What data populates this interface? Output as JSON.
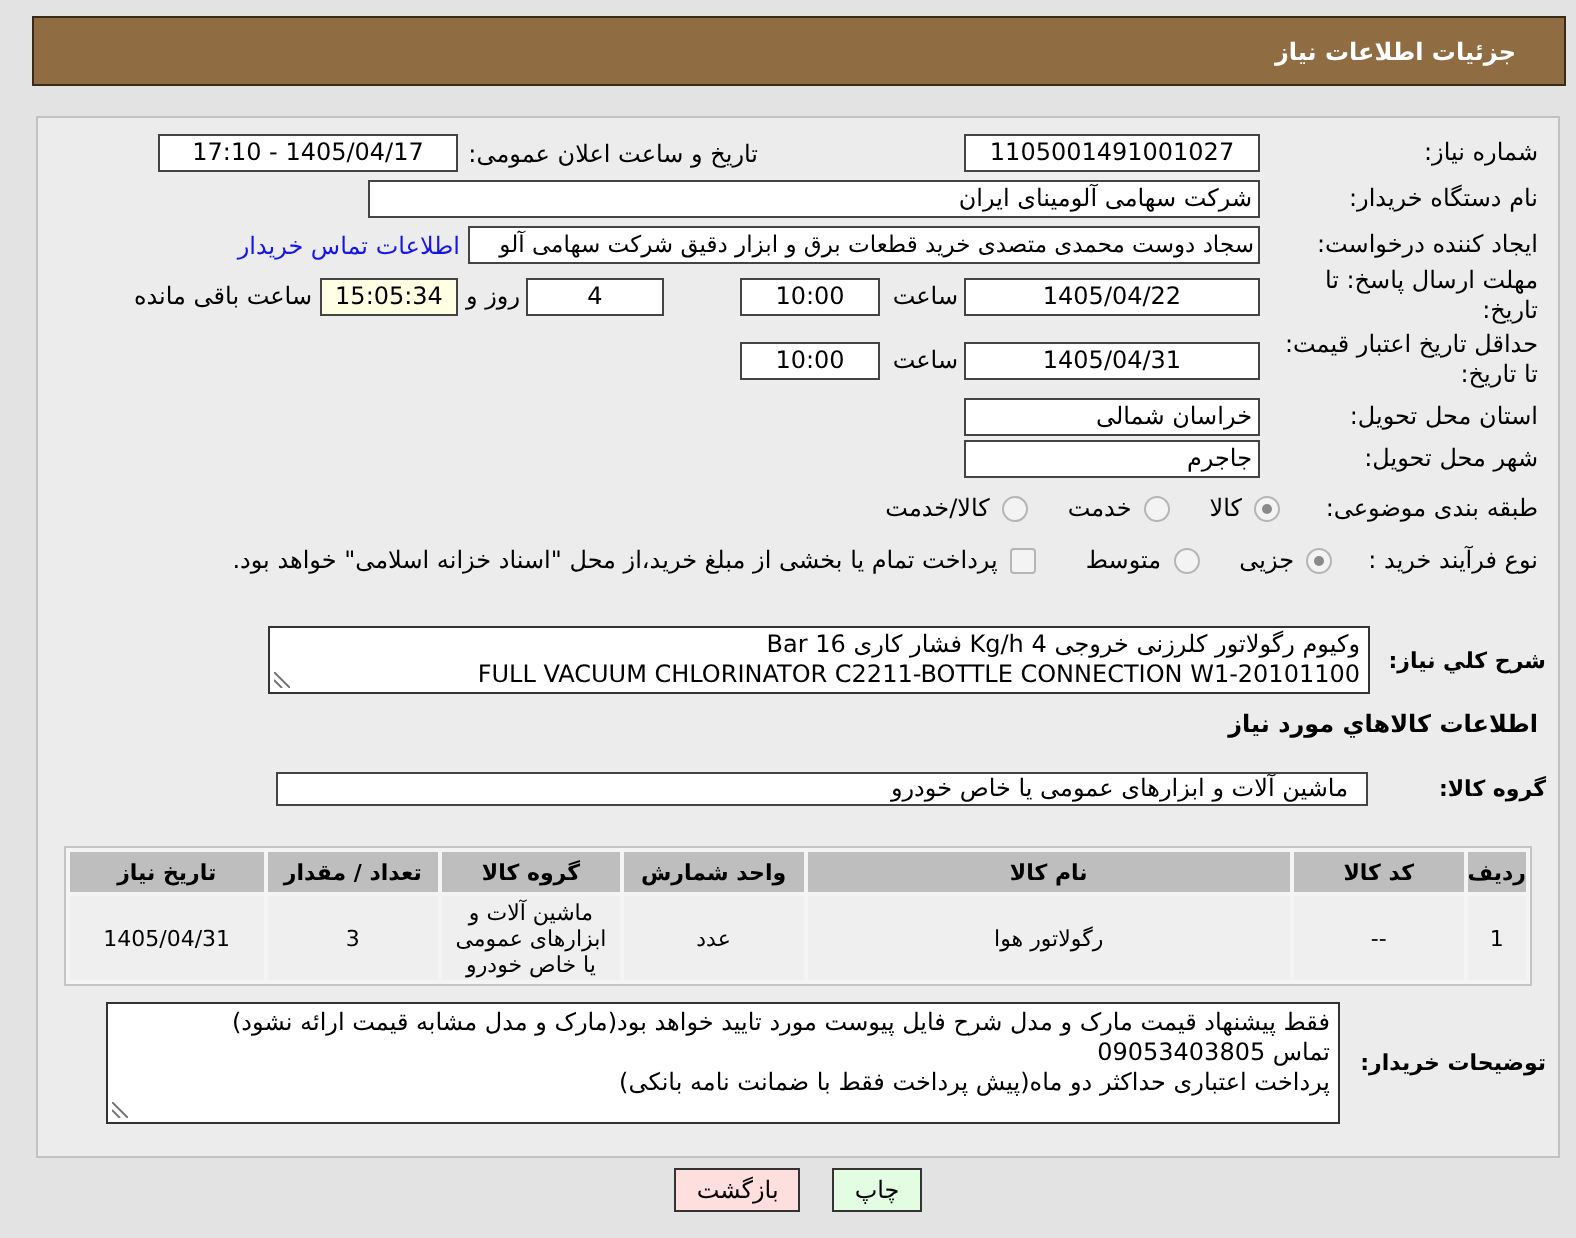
{
  "header": {
    "title": "جزئیات اطلاعات نیاز"
  },
  "need_number": {
    "label": "شماره نیاز:",
    "value": "1105001491001027"
  },
  "announce": {
    "label": "تاریخ و ساعت اعلان عمومی:",
    "value": "1405/04/17 - 17:10"
  },
  "buyer_org": {
    "label": "نام دستگاه خریدار:",
    "value": "شرکت سهامی آلومینای ایران"
  },
  "requester": {
    "label": "ایجاد کننده درخواست:",
    "value": "سجاد دوست محمدی متصدی خرید قطعات برق و ابزار دقیق شرکت سهامی آلو",
    "link": "اطلاعات تماس خریدار"
  },
  "response_deadline": {
    "label": "مهلت ارسال پاسخ: تا تاریخ:",
    "date": "1405/04/22",
    "time_label": "ساعت",
    "time": "10:00",
    "days": "4",
    "days_label": "روز و",
    "remaining": "15:05:34",
    "remaining_label": "ساعت باقی مانده"
  },
  "price_validity": {
    "label": "حداقل تاریخ اعتبار قیمت: تا تاریخ:",
    "date": "1405/04/31",
    "time_label": "ساعت",
    "time": "10:00"
  },
  "province": {
    "label": "استان محل تحویل:",
    "value": "خراسان شمالی"
  },
  "city": {
    "label": "شهر محل تحویل:",
    "value": "جاجرم"
  },
  "category": {
    "label": "طبقه بندی موضوعی:",
    "options": [
      {
        "label": "کالا",
        "selected": true
      },
      {
        "label": "خدمت",
        "selected": false
      },
      {
        "label": "کالا/خدمت",
        "selected": false
      }
    ]
  },
  "process": {
    "label": "نوع فرآیند خرید :",
    "options": [
      {
        "label": "جزیی",
        "selected": true
      },
      {
        "label": "متوسط",
        "selected": false
      }
    ],
    "treasury": {
      "label": "پرداخت تمام یا بخشی از مبلغ خرید،از محل \"اسناد خزانه اسلامی\" خواهد بود.",
      "checked": false
    }
  },
  "description": {
    "label": "شرح کلي نياز:",
    "lines": [
      "وکیوم رگولاتور کلرزنی خروجی 4 Kg/h فشار کاری 16 Bar",
      "FULL VACUUM CHLORINATOR C2211-BOTTLE CONNECTION W1-20101100"
    ]
  },
  "goods_section": {
    "title": "اطلاعات کالاهاي مورد نياز"
  },
  "goods_group": {
    "label": "گروه کالا:",
    "value": "ماشین آلات و ابزارهای عمومی یا خاص خودرو"
  },
  "table": {
    "columns": [
      "ردیف",
      "کد کالا",
      "نام کالا",
      "واحد شمارش",
      "گروه کالا",
      "تعداد / مقدار",
      "تاریخ نیاز"
    ],
    "rows": [
      [
        "1",
        "--",
        "رگولاتور هوا",
        "عدد",
        "ماشین آلات و ابزارهای عمومی یا خاص خودرو",
        "3",
        "1405/04/31"
      ]
    ]
  },
  "buyer_notes": {
    "label": "توضیحات خریدار:",
    "lines": [
      "فقط پیشنهاد قیمت مارک و مدل شرح فایل پیوست مورد تایید خواهد بود(مارک و مدل مشابه قیمت ارائه نشود)",
      "تماس 09053403805",
      "پرداخت اعتباری حداکثر دو ماه(پیش پرداخت فقط با ضمانت نامه بانکی)"
    ]
  },
  "buttons": [
    {
      "label": "چاپ",
      "kind": "print"
    },
    {
      "label": "بازگشت",
      "kind": "back"
    }
  ]
}
